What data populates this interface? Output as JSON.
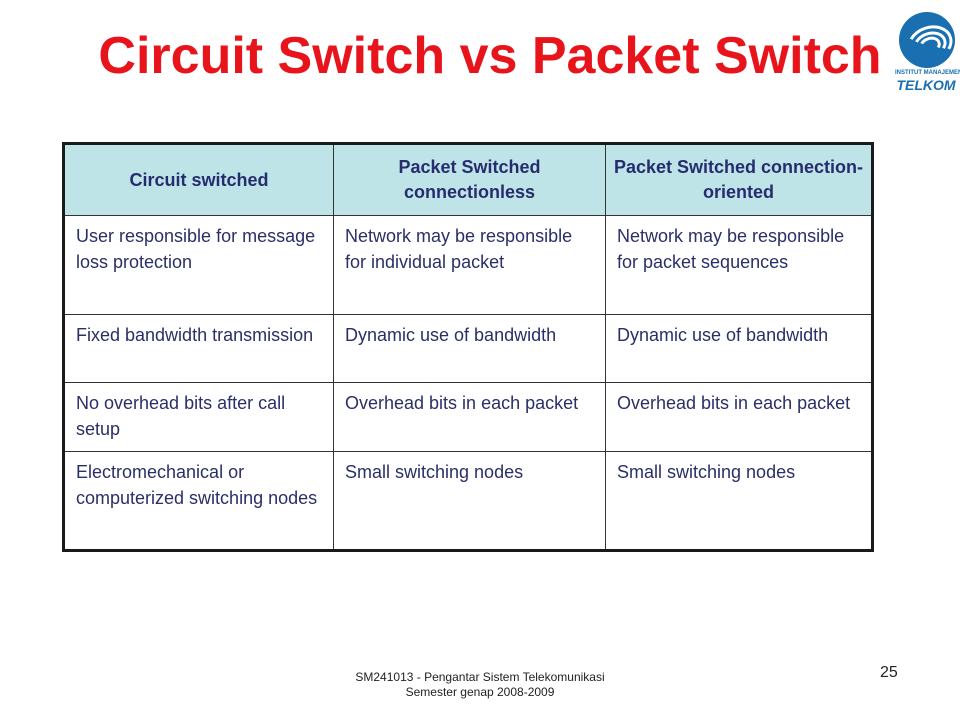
{
  "slide": {
    "title": "Circuit Switch vs Packet Switch",
    "logo": {
      "icon": "telkom-logo-icon",
      "subtitle": "INSTITUT MANAJEMEN",
      "name": "TELKOM",
      "color": "#1a6fb0"
    },
    "title_color": "#e8141c",
    "table": {
      "headers": [
        "Circuit switched",
        "Packet Switched connectionless",
        "Packet Switched connection-oriented"
      ],
      "rows": [
        [
          "User responsible for message loss protection",
          "Network may be responsible for individual packet",
          "Network may be responsible for packet sequences"
        ],
        [
          "Fixed bandwidth transmission",
          "Dynamic use of bandwidth",
          "Dynamic use of bandwidth"
        ],
        [
          "No overhead bits after call setup",
          "Overhead bits in each packet",
          "Overhead bits in each packet"
        ],
        [
          "Electromechanical or computerized switching nodes",
          "Small switching nodes",
          "Small switching nodes"
        ]
      ],
      "header_bg": "#bfe4e8"
    },
    "footer": {
      "line1": "SM241013 - Pengantar Sistem Telekomunikasi",
      "line2": "Semester genap 2008-2009"
    },
    "page_number": "25"
  }
}
